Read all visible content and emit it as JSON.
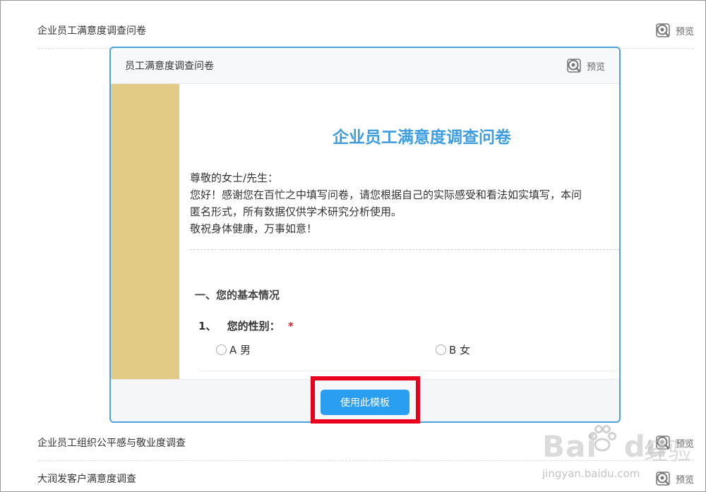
{
  "list": {
    "items": [
      {
        "title": "企业员工满意度调查问卷",
        "preview": "预览"
      },
      {
        "title": "企业员工组织公平感与敬业度调查",
        "preview": "预览"
      },
      {
        "title": "大润发客户满意度调查",
        "preview": "预览"
      }
    ]
  },
  "card": {
    "title": "员工满意度调查问卷",
    "preview": "预览",
    "doc": {
      "heading": "企业员工满意度调查问卷",
      "intro_lines": [
        "尊敬的女士/先生：",
        "您好！感谢您在百忙之中填写问卷，请您根据自己的实际感受和看法如实填写，本问",
        "匿名形式，所有数据仅供学术研究分析使用。",
        "敬祝身体健康，万事如意！"
      ],
      "section": "一、您的基本情况",
      "question": {
        "number": "1、",
        "text": "您的性别：",
        "required": "*"
      },
      "options": [
        "A 男",
        "B 女"
      ]
    },
    "use_button": "使用此模板"
  },
  "watermark": {
    "brand": "Bai",
    "brand2": "du",
    "cn": "经验",
    "url": "jingyan.baidu.com"
  },
  "colors": {
    "accent": "#2a9ff2",
    "highlight": "#e8001c",
    "gold": "#e2cc85",
    "heading": "#3d9de0"
  }
}
